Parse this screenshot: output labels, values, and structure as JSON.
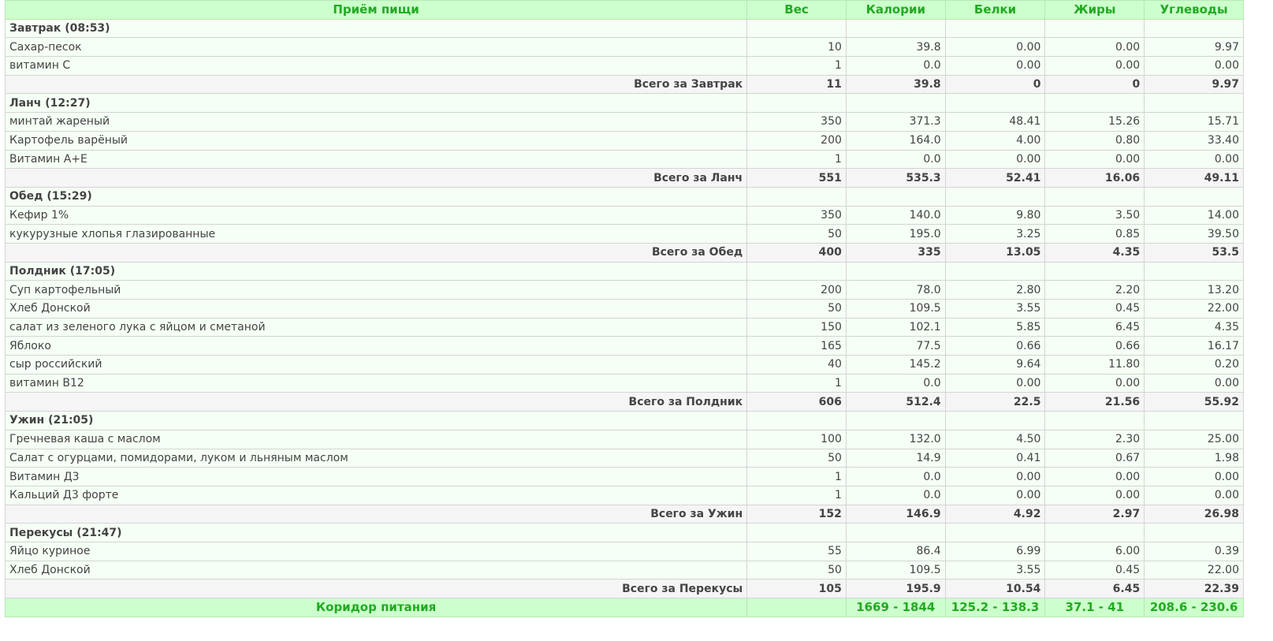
{
  "header": {
    "meal": "Приём пищи",
    "weight": "Вес",
    "calories": "Калории",
    "protein": "Белки",
    "fat": "Жиры",
    "carbs": "Углеводы"
  },
  "meals": [
    {
      "title": "Завтрак (08:53)",
      "items": [
        {
          "name": "Сахар-песок",
          "weight": "10",
          "calories": "39.8",
          "protein": "0.00",
          "fat": "0.00",
          "carbs": "9.97"
        },
        {
          "name": "витамин С",
          "weight": "1",
          "calories": "0.0",
          "protein": "0.00",
          "fat": "0.00",
          "carbs": "0.00"
        }
      ],
      "total": {
        "label": "Всего за Завтрак",
        "weight": "11",
        "calories": "39.8",
        "protein": "0",
        "fat": "0",
        "carbs": "9.97"
      }
    },
    {
      "title": "Ланч (12:27)",
      "items": [
        {
          "name": "минтай жареный",
          "weight": "350",
          "calories": "371.3",
          "protein": "48.41",
          "fat": "15.26",
          "carbs": "15.71"
        },
        {
          "name": "Картофель варёный",
          "weight": "200",
          "calories": "164.0",
          "protein": "4.00",
          "fat": "0.80",
          "carbs": "33.40"
        },
        {
          "name": "Витамин А+Е",
          "weight": "1",
          "calories": "0.0",
          "protein": "0.00",
          "fat": "0.00",
          "carbs": "0.00"
        }
      ],
      "total": {
        "label": "Всего за Ланч",
        "weight": "551",
        "calories": "535.3",
        "protein": "52.41",
        "fat": "16.06",
        "carbs": "49.11"
      }
    },
    {
      "title": "Обед (15:29)",
      "items": [
        {
          "name": "Кефир 1%",
          "weight": "350",
          "calories": "140.0",
          "protein": "9.80",
          "fat": "3.50",
          "carbs": "14.00"
        },
        {
          "name": "кукурузные хлопья глазированные",
          "weight": "50",
          "calories": "195.0",
          "protein": "3.25",
          "fat": "0.85",
          "carbs": "39.50"
        }
      ],
      "total": {
        "label": "Всего за Обед",
        "weight": "400",
        "calories": "335",
        "protein": "13.05",
        "fat": "4.35",
        "carbs": "53.5"
      }
    },
    {
      "title": "Полдник (17:05)",
      "items": [
        {
          "name": "Суп картофельный",
          "weight": "200",
          "calories": "78.0",
          "protein": "2.80",
          "fat": "2.20",
          "carbs": "13.20"
        },
        {
          "name": "Хлеб Донской",
          "weight": "50",
          "calories": "109.5",
          "protein": "3.55",
          "fat": "0.45",
          "carbs": "22.00"
        },
        {
          "name": "салат из зеленого лука с яйцом и сметаной",
          "weight": "150",
          "calories": "102.1",
          "protein": "5.85",
          "fat": "6.45",
          "carbs": "4.35"
        },
        {
          "name": "Яблоко",
          "weight": "165",
          "calories": "77.5",
          "protein": "0.66",
          "fat": "0.66",
          "carbs": "16.17"
        },
        {
          "name": "сыр российский",
          "weight": "40",
          "calories": "145.2",
          "protein": "9.64",
          "fat": "11.80",
          "carbs": "0.20"
        },
        {
          "name": "витамин В12",
          "weight": "1",
          "calories": "0.0",
          "protein": "0.00",
          "fat": "0.00",
          "carbs": "0.00"
        }
      ],
      "total": {
        "label": "Всего за Полдник",
        "weight": "606",
        "calories": "512.4",
        "protein": "22.5",
        "fat": "21.56",
        "carbs": "55.92"
      }
    },
    {
      "title": "Ужин (21:05)",
      "items": [
        {
          "name": "Гречневая каша с маслом",
          "weight": "100",
          "calories": "132.0",
          "protein": "4.50",
          "fat": "2.30",
          "carbs": "25.00"
        },
        {
          "name": "Салат с огурцами, помидорами, луком и льняным маслом",
          "weight": "50",
          "calories": "14.9",
          "protein": "0.41",
          "fat": "0.67",
          "carbs": "1.98"
        },
        {
          "name": "Витамин Д3",
          "weight": "1",
          "calories": "0.0",
          "protein": "0.00",
          "fat": "0.00",
          "carbs": "0.00"
        },
        {
          "name": "Кальций Д3 форте",
          "weight": "1",
          "calories": "0.0",
          "protein": "0.00",
          "fat": "0.00",
          "carbs": "0.00"
        }
      ],
      "total": {
        "label": "Всего за Ужин",
        "weight": "152",
        "calories": "146.9",
        "protein": "4.92",
        "fat": "2.97",
        "carbs": "26.98"
      }
    },
    {
      "title": "Перекусы (21:47)",
      "items": [
        {
          "name": "Яйцо куриное",
          "weight": "55",
          "calories": "86.4",
          "protein": "6.99",
          "fat": "6.00",
          "carbs": "0.39"
        },
        {
          "name": "Хлеб Донской",
          "weight": "50",
          "calories": "109.5",
          "protein": "3.55",
          "fat": "0.45",
          "carbs": "22.00"
        }
      ],
      "total": {
        "label": "Всего за Перекусы",
        "weight": "105",
        "calories": "195.9",
        "protein": "10.54",
        "fat": "6.45",
        "carbs": "22.39"
      }
    }
  ],
  "corridor": {
    "label": "Коридор питания",
    "weight": "",
    "calories": "1669 - 1844",
    "protein": "125.2 - 138.3",
    "fat": "37.1 - 41",
    "carbs": "208.6 - 230.6"
  },
  "colors": {
    "header_bg": "#ccffcc",
    "header_text": "#22aa22",
    "row_bg": "#f5fff5",
    "total_bg": "#f5f5f5"
  }
}
